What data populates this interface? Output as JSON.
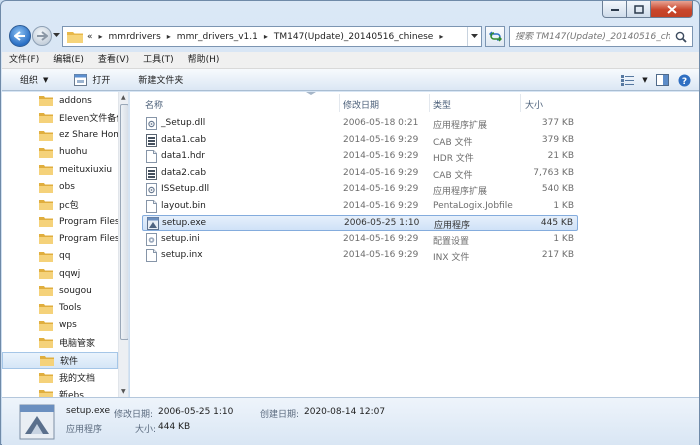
{
  "address": {
    "overflow": "«",
    "crumbs": [
      "mmrdrivers",
      "mmr_drivers_v1.1",
      "TM147(Update)_20140516_chinese"
    ]
  },
  "search": {
    "placeholder": "搜索 TM147(Update)_20140516_ch..."
  },
  "menu": [
    "文件(F)",
    "编辑(E)",
    "查看(V)",
    "工具(T)",
    "帮助(H)"
  ],
  "toolbar": {
    "organize": "组织",
    "open": "打开",
    "new_folder": "新建文件夹"
  },
  "nav_tree": [
    "addons",
    "Eleven文件备份",
    "ez Share Hom",
    "huohu",
    "meituxiuxiu",
    "obs",
    "pc包",
    "Program Files",
    "Program Files",
    "qq",
    "qqwj",
    "sougou",
    "Tools",
    "wps",
    "电脑管家",
    "软件",
    "我的文档",
    "新ebs"
  ],
  "nav_selected_index": 15,
  "columns": {
    "name": "名称",
    "date": "修改日期",
    "type": "类型",
    "size": "大小"
  },
  "files": [
    {
      "name": "_Setup.dll",
      "date": "2006-05-18 0:21",
      "type": "应用程序扩展",
      "size": "377 KB",
      "icon": "dll-icon"
    },
    {
      "name": "data1.cab",
      "date": "2014-05-16 9:29",
      "type": "CAB 文件",
      "size": "379 KB",
      "icon": "cab-icon"
    },
    {
      "name": "data1.hdr",
      "date": "2014-05-16 9:29",
      "type": "HDR 文件",
      "size": "21 KB",
      "icon": "file-icon"
    },
    {
      "name": "data2.cab",
      "date": "2014-05-16 9:29",
      "type": "CAB 文件",
      "size": "7,763 KB",
      "icon": "cab-icon"
    },
    {
      "name": "ISSetup.dll",
      "date": "2014-05-16 9:29",
      "type": "应用程序扩展",
      "size": "540 KB",
      "icon": "dll-icon"
    },
    {
      "name": "layout.bin",
      "date": "2014-05-16 9:29",
      "type": "PentaLogix.Jobfile",
      "size": "1 KB",
      "icon": "file-icon"
    },
    {
      "name": "setup.exe",
      "date": "2006-05-25 1:10",
      "type": "应用程序",
      "size": "445 KB",
      "icon": "exe-icon"
    },
    {
      "name": "setup.ini",
      "date": "2014-05-16 9:29",
      "type": "配置设置",
      "size": "1 KB",
      "icon": "ini-icon"
    },
    {
      "name": "setup.inx",
      "date": "2014-05-16 9:29",
      "type": "INX 文件",
      "size": "217 KB",
      "icon": "file-icon"
    }
  ],
  "selected_file_index": 6,
  "details": {
    "name": "setup.exe",
    "modified_label": "修改日期:",
    "modified": "2006-05-25 1:10",
    "created_label": "创建日期:",
    "created": "2020-08-14 12:07",
    "type": "应用程序",
    "size_label": "大小:",
    "size": "444 KB"
  },
  "colors": {
    "accent": "#2a6fc4",
    "selection": "#cfe2f7",
    "close": "#c9462c"
  }
}
